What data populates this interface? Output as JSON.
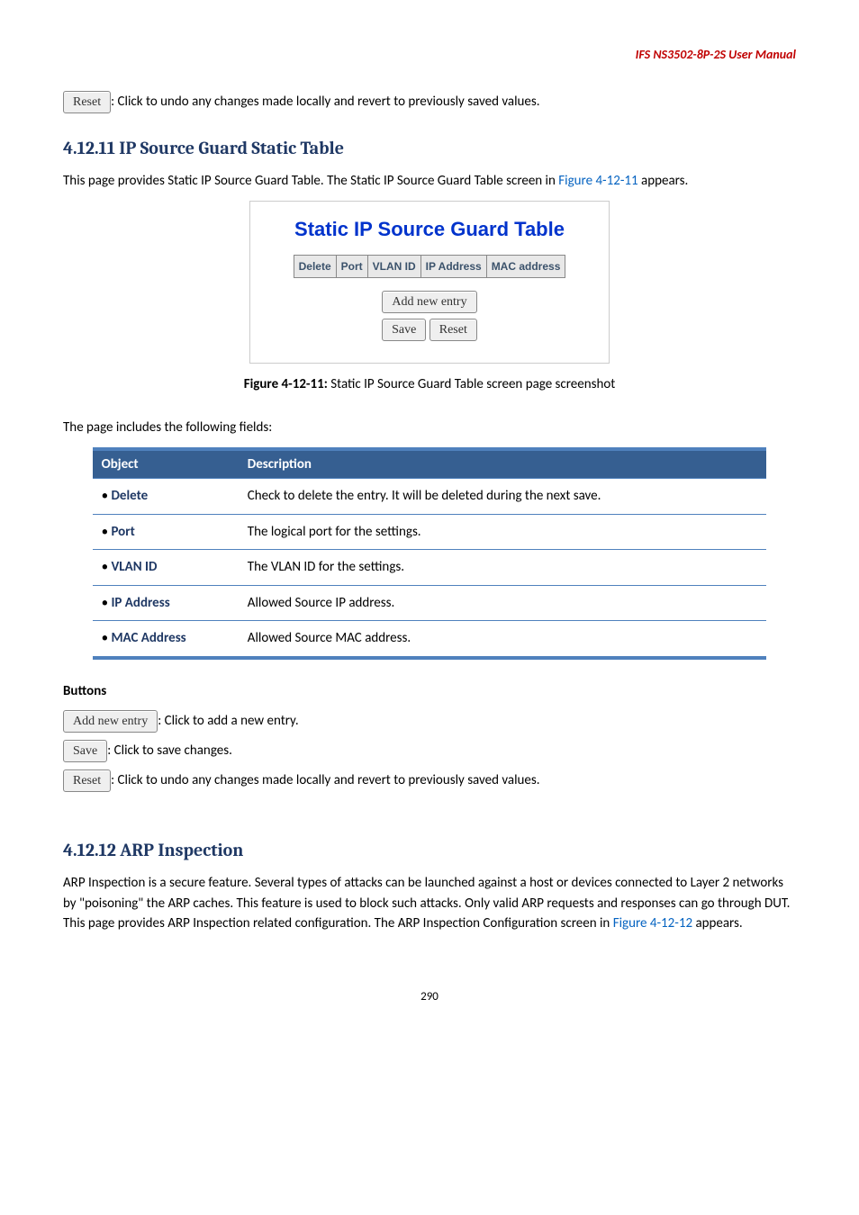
{
  "header": {
    "title": "IFS NS3502-8P-2S  User Manual"
  },
  "intro_reset": {
    "btn": "Reset",
    "text": ": Click to undo any changes made locally and revert to previously saved values."
  },
  "section1": {
    "title": "4.12.11 IP Source Guard Static Table",
    "para1a": "This page provides Static IP Source Guard Table. The Static IP Source Guard Table screen in ",
    "link1": "Figure 4-12-11",
    "para1b": " appears.",
    "fig": {
      "title": "Static IP Source Guard Table",
      "cols": [
        "Delete",
        "Port",
        "VLAN ID",
        "IP Address",
        "MAC address"
      ],
      "add_btn": "Add new entry",
      "save_btn": "Save",
      "reset_btn": "Reset"
    },
    "caption_b": "Figure 4-12-11:",
    "caption_t": " Static IP Source Guard Table screen page screenshot",
    "fields_intro": "The page includes the following fields:",
    "table": {
      "h1": "Object",
      "h2": "Description",
      "rows": [
        {
          "label": "Delete",
          "desc": "Check to delete the entry. It will be deleted during the next save."
        },
        {
          "label": "Port",
          "desc": "The logical port for the settings."
        },
        {
          "label": "VLAN ID",
          "desc": "The VLAN ID for the settings."
        },
        {
          "label": "IP Address",
          "desc": "Allowed Source IP address."
        },
        {
          "label": "MAC Address",
          "desc": "Allowed Source MAC address."
        }
      ]
    },
    "buttons_heading": "Buttons",
    "btn_lines": [
      {
        "btn": "Add new entry",
        "text": ": Click to add a new entry."
      },
      {
        "btn": "Save",
        "text": ": Click to save changes."
      },
      {
        "btn": "Reset",
        "text": ": Click to undo any changes made locally and revert to previously saved values."
      }
    ]
  },
  "section2": {
    "title": "4.12.12 ARP Inspection",
    "para_a": "ARP Inspection is a secure feature. Several types of attacks can be launched against a host or devices connected to Layer 2 networks by \"poisoning\" the ARP caches. This feature is used to block such attacks. Only valid ARP requests and responses can go through DUT. This page provides ARP Inspection related configuration. The ARP Inspection Configuration screen in ",
    "link": "Figure 4-12-12",
    "para_b": " appears."
  },
  "footer": {
    "page": "290"
  }
}
